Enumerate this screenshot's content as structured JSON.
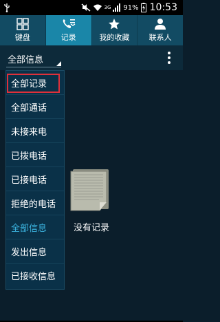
{
  "status_bar": {
    "network_label": "3G",
    "battery_percent": "91%",
    "time": "10:53"
  },
  "tabs": [
    {
      "label": "键盘",
      "icon": "keypad-icon",
      "active": false
    },
    {
      "label": "记录",
      "icon": "call-log-icon",
      "active": true
    },
    {
      "label": "我的收藏",
      "icon": "star-icon",
      "active": false
    },
    {
      "label": "联系人",
      "icon": "person-icon",
      "active": false
    }
  ],
  "toolbar": {
    "filter_selected": "全部信息",
    "more_icon": "more-vertical-icon"
  },
  "dropdown": {
    "items": [
      "全部记录",
      "全部通话",
      "未接来电",
      "已拨电话",
      "已接电话",
      "拒绝的电话",
      "全部信息",
      "发出信息",
      "已接收信息"
    ],
    "current_index": 6,
    "highlight_index": 0,
    "highlight_color": "#e0303a",
    "current_color": "#3bb2de"
  },
  "empty_state": {
    "text": "没有记录",
    "icon": "notes-stack-icon"
  }
}
